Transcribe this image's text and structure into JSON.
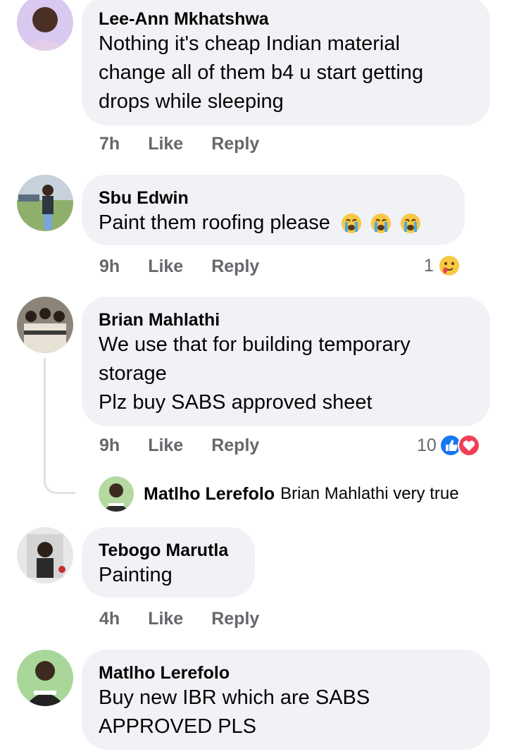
{
  "comments": [
    {
      "author": "Lee-Ann Mkhatshwa",
      "lines": [
        "Nothing it's cheap Indian material",
        "change all of them b4 u start getting",
        "drops while sleeping"
      ],
      "time": "7h",
      "like": "Like",
      "reply": "Reply"
    },
    {
      "author": "Sbu Edwin",
      "lines": [
        "Paint them roofing please"
      ],
      "time": "9h",
      "like": "Like",
      "reply": "Reply",
      "reaction_count": "1"
    },
    {
      "author": "Brian Mahlathi",
      "lines": [
        "We use that for building temporary",
        "storage",
        "Plz buy SABS approved sheet"
      ],
      "time": "9h",
      "like": "Like",
      "reply": "Reply",
      "reaction_count": "10",
      "reply_preview": {
        "author": "Matlho Lerefolo",
        "text": "Brian Mahlathi very true"
      }
    },
    {
      "author": "Tebogo Marutla",
      "lines": [
        "Painting"
      ],
      "time": "4h",
      "like": "Like",
      "reply": "Reply"
    },
    {
      "author": "Matlho Lerefolo",
      "lines": [
        "Buy new IBR which are SABS",
        "APPROVED PLS"
      ]
    }
  ],
  "colors": {
    "bubble": "#f0f2f5",
    "meta": "#65676b",
    "like_blue": "#1877f2",
    "love_red": "#f33e58"
  },
  "icons": {
    "crying": "loudly-crying-face-icon",
    "care": "care-reaction-icon",
    "like": "like-reaction-icon",
    "love": "love-reaction-icon"
  }
}
